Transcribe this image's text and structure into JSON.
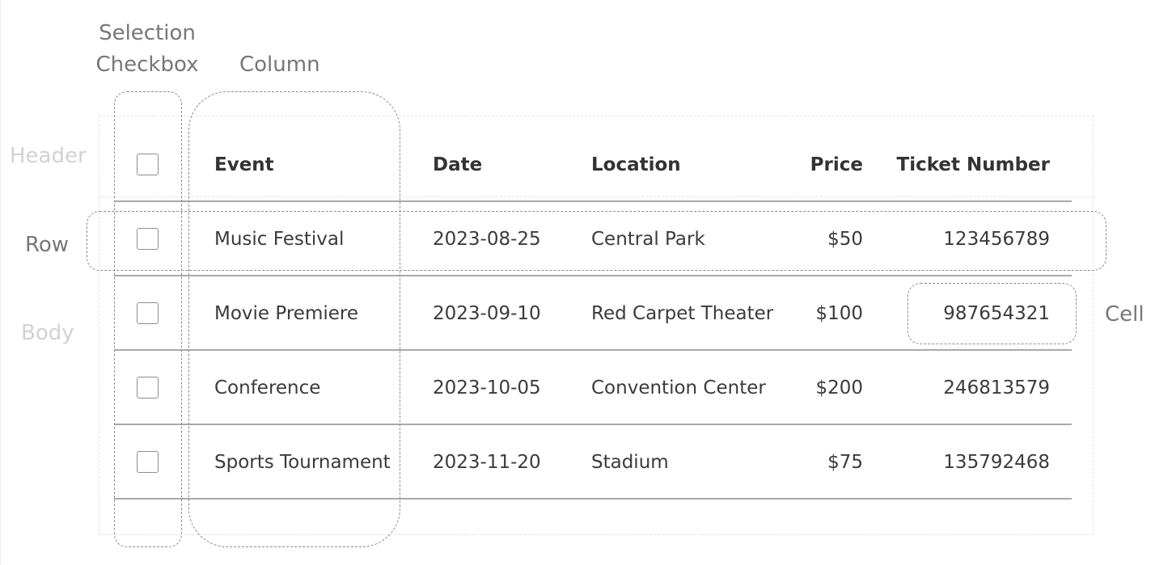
{
  "annotations": {
    "selection_checkbox": [
      "Selection",
      "Checkbox"
    ],
    "column": "Column",
    "header": "Header",
    "row": "Row",
    "body": "Body",
    "cell": "Cell"
  },
  "table": {
    "columns": [
      "Event",
      "Date",
      "Location",
      "Price",
      "Ticket Number"
    ],
    "rows": [
      {
        "event": "Music Festival",
        "date": "2023-08-25",
        "location": "Central Park",
        "price": "$50",
        "ticket": "123456789"
      },
      {
        "event": "Movie Premiere",
        "date": "2023-09-10",
        "location": "Red Carpet Theater",
        "price": "$100",
        "ticket": "987654321"
      },
      {
        "event": "Conference",
        "date": "2023-10-05",
        "location": "Convention Center",
        "price": "$200",
        "ticket": "246813579"
      },
      {
        "event": "Sports Tournament",
        "date": "2023-11-20",
        "location": "Stadium",
        "price": "$75",
        "ticket": "135792468"
      }
    ]
  }
}
